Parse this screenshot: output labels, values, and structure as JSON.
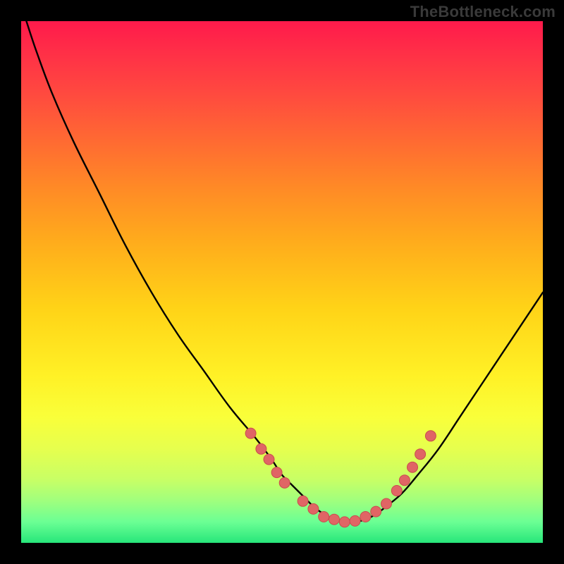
{
  "watermark": "TheBottleneck.com",
  "colors": {
    "background": "#000000",
    "curve": "#000000",
    "marker_fill": "#e06565",
    "marker_stroke": "#c94d4d"
  },
  "chart_data": {
    "type": "line",
    "title": "",
    "xlabel": "",
    "ylabel": "",
    "xlim": [
      0,
      100
    ],
    "ylim": [
      0,
      100
    ],
    "series": [
      {
        "name": "bottleneck-curve",
        "x": [
          1,
          3,
          6,
          10,
          15,
          20,
          25,
          30,
          35,
          40,
          45,
          48,
          50,
          52,
          54,
          56,
          58,
          60,
          62,
          64,
          66,
          68,
          70,
          73,
          76,
          80,
          84,
          88,
          92,
          96,
          100
        ],
        "y": [
          100,
          94,
          86,
          77,
          67,
          57,
          48,
          40,
          33,
          26,
          20,
          16,
          13,
          11,
          9,
          7,
          5.5,
          4.5,
          4,
          4,
          4.5,
          5.5,
          7,
          9.5,
          13,
          18,
          24,
          30,
          36,
          42,
          48
        ]
      }
    ],
    "markers": [
      {
        "x": 44,
        "y": 21
      },
      {
        "x": 46,
        "y": 18
      },
      {
        "x": 47.5,
        "y": 16
      },
      {
        "x": 49,
        "y": 13.5
      },
      {
        "x": 50.5,
        "y": 11.5
      },
      {
        "x": 54,
        "y": 8
      },
      {
        "x": 56,
        "y": 6.5
      },
      {
        "x": 58,
        "y": 5
      },
      {
        "x": 60,
        "y": 4.5
      },
      {
        "x": 62,
        "y": 4
      },
      {
        "x": 64,
        "y": 4.2
      },
      {
        "x": 66,
        "y": 5
      },
      {
        "x": 68,
        "y": 6
      },
      {
        "x": 70,
        "y": 7.5
      },
      {
        "x": 72,
        "y": 10
      },
      {
        "x": 73.5,
        "y": 12
      },
      {
        "x": 75,
        "y": 14.5
      },
      {
        "x": 76.5,
        "y": 17
      },
      {
        "x": 78.5,
        "y": 20.5
      }
    ]
  }
}
